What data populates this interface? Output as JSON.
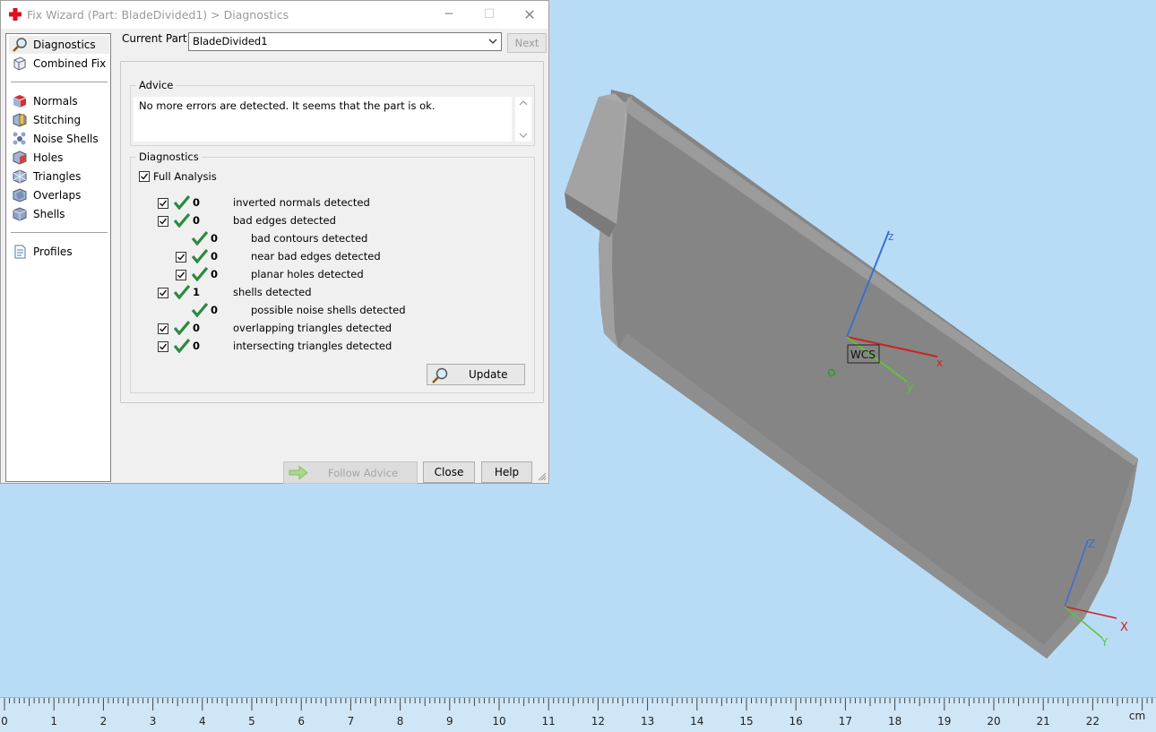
{
  "window": {
    "title": "Fix Wizard (Part: BladeDivided1) > Diagnostics",
    "minimize": "─",
    "maximize": "☐",
    "close": "✕"
  },
  "nav": {
    "items": [
      {
        "label": "Diagnostics",
        "icon": "magnifier-icon",
        "selected": true
      },
      {
        "label": "Combined Fix",
        "icon": "cube-icon"
      },
      {
        "label": "Normals",
        "icon": "normals-icon"
      },
      {
        "label": "Stitching",
        "icon": "stitching-icon"
      },
      {
        "label": "Noise Shells",
        "icon": "noise-shells-icon"
      },
      {
        "label": "Holes",
        "icon": "holes-icon"
      },
      {
        "label": "Triangles",
        "icon": "triangles-icon"
      },
      {
        "label": "Overlaps",
        "icon": "overlaps-icon"
      },
      {
        "label": "Shells",
        "icon": "shells-icon"
      },
      {
        "label": "Profiles",
        "icon": "document-icon"
      }
    ]
  },
  "current_part": {
    "label": "Current Part:",
    "value": "BladeDivided1",
    "next_label": "Next"
  },
  "advice": {
    "title": "Advice",
    "text": "No more errors are detected. It seems that the part is ok."
  },
  "diagnostics": {
    "title": "Diagnostics",
    "full_analysis_label": "Full Analysis",
    "full_analysis_checked": true,
    "rows": [
      {
        "count": "0",
        "label": "inverted normals detected",
        "checked": true
      },
      {
        "count": "0",
        "label": "bad edges detected",
        "checked": true
      },
      {
        "count": "0",
        "label": "bad contours detected"
      },
      {
        "count": "0",
        "label": "near bad edges detected",
        "checked": true
      },
      {
        "count": "0",
        "label": "planar holes detected",
        "checked": true
      },
      {
        "count": "1",
        "label": "shells detected",
        "checked": true
      },
      {
        "count": "0",
        "label": "possible noise shells detected"
      },
      {
        "count": "0",
        "label": "overlapping triangles detected",
        "checked": true
      },
      {
        "count": "0",
        "label": "intersecting triangles detected",
        "checked": true
      }
    ],
    "update_label": "Update"
  },
  "footer": {
    "follow_advice": "Follow Advice",
    "close": "Close",
    "help": "Help"
  },
  "viewport": {
    "wcs_label": "WCS",
    "axis_x": "x",
    "axis_y": "y",
    "axis_z": "z",
    "mini_x": "X",
    "mini_y": "Y",
    "mini_z": "Z",
    "color_x": "#d02020",
    "color_y": "#5ec43a",
    "color_z": "#3a6fd0"
  },
  "ruler": {
    "ticks": [
      "0",
      "1",
      "2",
      "3",
      "4",
      "5",
      "6",
      "7",
      "8",
      "9",
      "10",
      "11",
      "12",
      "13",
      "14",
      "15",
      "16",
      "17",
      "18",
      "19",
      "20",
      "21",
      "22"
    ],
    "unit": "cm"
  }
}
